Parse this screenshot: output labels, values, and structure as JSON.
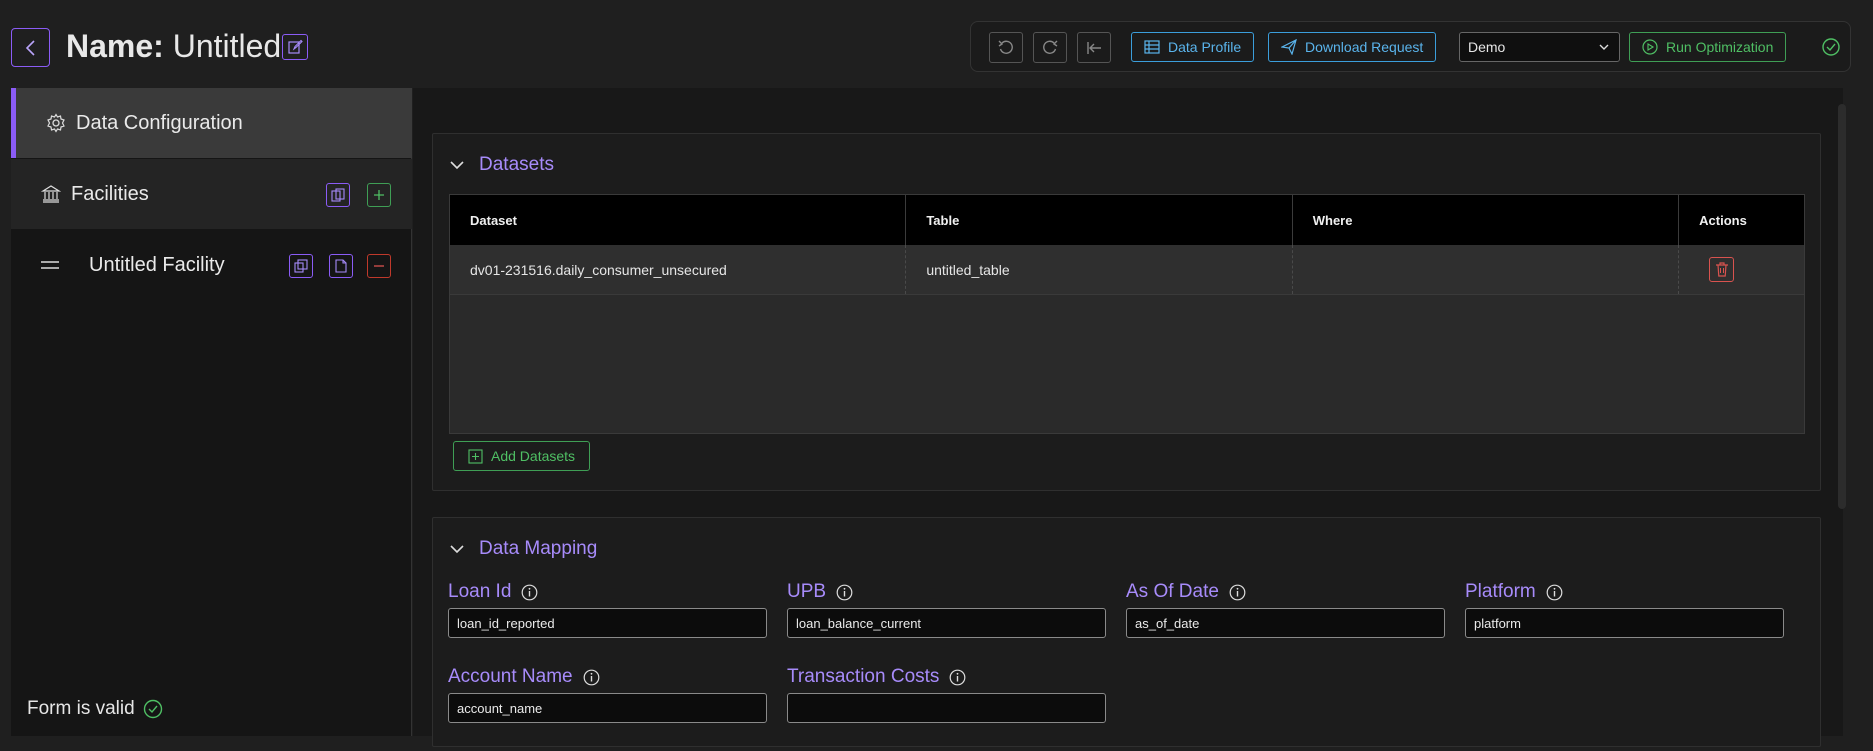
{
  "header": {
    "name_label": "Name:",
    "name_value": "Untitled",
    "data_profile_label": "Data Profile",
    "download_request_label": "Download Request",
    "environment_value": "Demo",
    "run_optimization_label": "Run Optimization"
  },
  "sidebar": {
    "items": [
      {
        "label": "Data Configuration"
      },
      {
        "label": "Facilities"
      },
      {
        "label": "Untitled Facility"
      }
    ],
    "form_status": "Form is valid"
  },
  "datasets": {
    "title": "Datasets",
    "columns": [
      "Dataset",
      "Table",
      "Where",
      "Actions"
    ],
    "rows": [
      {
        "dataset": "dv01-231516.daily_consumer_unsecured",
        "table": "untitled_table",
        "where": ""
      }
    ],
    "add_label": "Add Datasets"
  },
  "mapping": {
    "title": "Data Mapping",
    "fields": [
      {
        "label": "Loan Id",
        "value": "loan_id_reported"
      },
      {
        "label": "UPB",
        "value": "loan_balance_current"
      },
      {
        "label": "As Of Date",
        "value": "as_of_date"
      },
      {
        "label": "Platform",
        "value": "platform"
      },
      {
        "label": "Account Name",
        "value": "account_name"
      },
      {
        "label": "Transaction Costs",
        "value": ""
      }
    ]
  },
  "colors": {
    "accent": "#8b5cf6",
    "blue_action": "#3b9edb",
    "green_action": "#3f9e55",
    "danger": "#d9534f"
  }
}
